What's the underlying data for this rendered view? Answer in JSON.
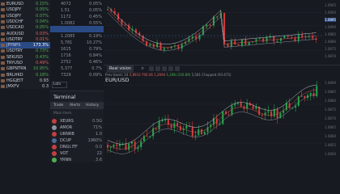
{
  "watchlist": {
    "items": [
      {
        "symbol": "EURUSD",
        "change": "0.15%",
        "color": "#4caf50"
      },
      {
        "symbol": "USDJPY",
        "change": "0.05%",
        "color": "#4caf50"
      },
      {
        "symbol": "USDJPY",
        "change": "0.07%",
        "color": "#4caf50"
      },
      {
        "symbol": "USDCHF",
        "change": "0.04%",
        "color": "#4caf50"
      },
      {
        "symbol": "USDCAD",
        "change": "0.05%",
        "color": "#4caf50"
      },
      {
        "symbol": "AUDUSD",
        "change": "0.03%",
        "color": "#e06060"
      },
      {
        "symbol": "USDTRY",
        "change": "0.01%",
        "color": "#e06060"
      },
      {
        "symbol": "JPYNPS",
        "change": "173.3%",
        "color": "#ffffff"
      },
      {
        "symbol": "USDTRY",
        "change": "0.73%",
        "color": "#4caf50"
      },
      {
        "symbol": "SEKUSD",
        "change": "0.43%",
        "color": "#4caf50"
      },
      {
        "symbol": "TRYUSD",
        "change": "0.49%",
        "color": "#e06060"
      },
      {
        "symbol": "GBPNTRN",
        "change": "10.95%",
        "color": "#4caf50"
      },
      {
        "symbol": "BRLHKD",
        "change": "0.18%",
        "color": "#4caf50"
      },
      {
        "symbol": "HGGJEIT",
        "change": "0.93",
        "color": "#c8ccd4"
      },
      {
        "symbol": "JMXFV",
        "change": "0.3",
        "color": "#c8ccd4"
      }
    ]
  },
  "middle": {
    "rows": [
      {
        "a": "4072",
        "b": "0.05%"
      },
      {
        "a": "1.51",
        "b": "0.05%"
      },
      {
        "a": "1172",
        "b": "0.45%"
      },
      {
        "a": "1.0082",
        "b": "0.55%"
      },
      {
        "a": "0.1245",
        "b": "0.25%"
      },
      {
        "a": "1.2085",
        "b": "0.19%"
      },
      {
        "a": "5,781",
        "b": "10.27%"
      },
      {
        "a": "1615",
        "b": "0.79%"
      },
      {
        "a": "1716",
        "b": "0.84%"
      },
      {
        "a": "2752",
        "b": "0.46%"
      },
      {
        "a": "5,377",
        "b": "0.7%"
      },
      {
        "a": "7329",
        "b": "0.09%"
      }
    ],
    "lots_label": "Lots"
  },
  "terminal": {
    "title": "Terminal",
    "tabs": [
      "Trade",
      "Alerts",
      "History"
    ],
    "header": "Main Item",
    "rows": [
      {
        "name": "XEURS",
        "value": "0.5G",
        "color": "#c24040"
      },
      {
        "name": "AMOR",
        "value": "71%",
        "color": "#8d939c"
      },
      {
        "name": "URNRB",
        "value": "1.0",
        "color": "#c24040"
      },
      {
        "name": "DCUP",
        "value": "1960%",
        "color": "#4a6a9a"
      },
      {
        "name": "DNGI.ITF",
        "value": "0.0",
        "color": "#c24040"
      },
      {
        "name": "VOT",
        "value": "22",
        "color": "#c24040"
      },
      {
        "name": "YRNN",
        "value": "3.6",
        "color": "#4caf50"
      }
    ]
  },
  "bottom_chart": {
    "tab_label": "Real vision",
    "close_icon": "close-icon",
    "symbol": "EUR/USD",
    "info_prefix": "Prev basel: 24",
    "info_red": "5,8933 700.06 1,2694",
    "info_green": "1,298 (100.89)",
    "info_suffix": "5,581 Chopped (93.675)"
  },
  "top_axis": [
    "1.0905",
    "1.0900",
    "1.0895",
    "1.0890",
    "1.0885",
    "1.0880",
    "1.0875",
    "1.0870"
  ],
  "bottom_axis": [
    "1.0890",
    "1.0885",
    "1.0880",
    "1.0875",
    "1.0870",
    "1.0865",
    "1.0860",
    "1.0855",
    "1.0850"
  ],
  "top_highlight_value": "1.0895",
  "colors": {
    "bull": "#1fa84a",
    "bear": "#d63a3a",
    "bg": "#171a20"
  }
}
